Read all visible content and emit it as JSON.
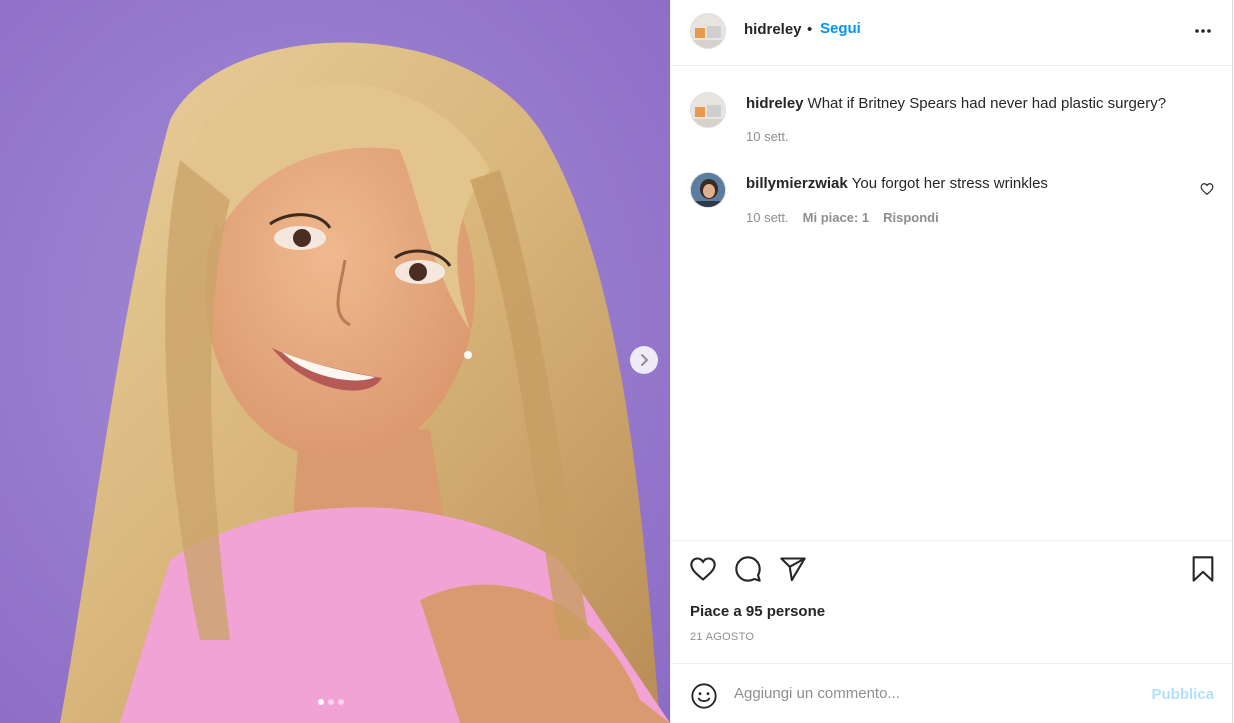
{
  "post": {
    "username": "hidreley",
    "separator": "•",
    "follow_label": "Segui"
  },
  "comments": [
    {
      "author": "hidreley",
      "text": "What if Britney Spears had never had plastic surgery?",
      "time": "10 sett."
    },
    {
      "author": "billymierzwiak",
      "text": "You forgot her stress wrinkles",
      "time": "10 sett.",
      "likes": "Mi piace: 1",
      "reply_label": "Rispondi"
    }
  ],
  "footer": {
    "likes_text": "Piace a 95 persone",
    "date": "21 AGOSTO"
  },
  "add_comment": {
    "placeholder": "Aggiungi un commento...",
    "publish_label": "Pubblica"
  },
  "carousel": {
    "current": 1,
    "total": 3
  },
  "colors": {
    "accent": "#0095f6",
    "accent_disabled": "#b2dffc",
    "photo_bg": "#9474c9",
    "shirt": "#f2a3d6"
  }
}
